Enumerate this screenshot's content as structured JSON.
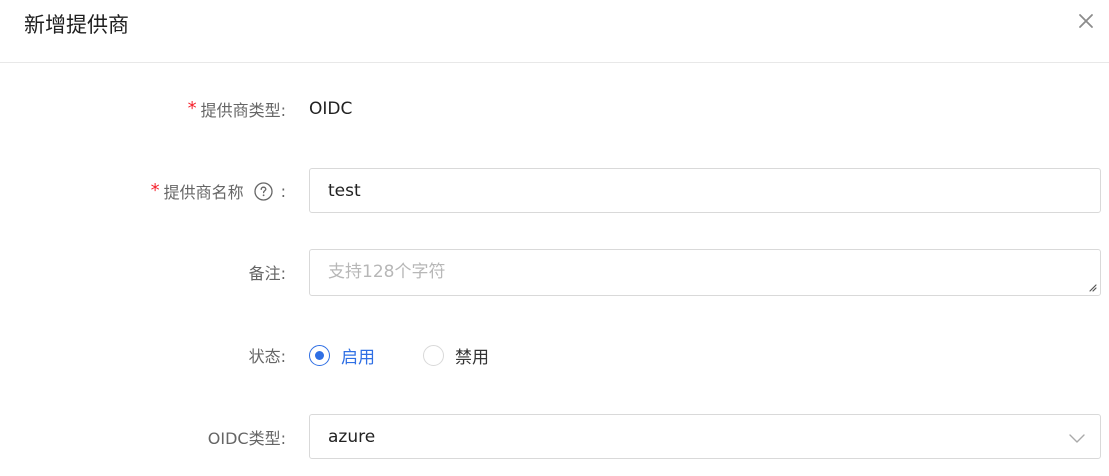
{
  "dialog": {
    "title": "新增提供商",
    "close_icon": "close-icon"
  },
  "form": {
    "provider_type": {
      "required": "*",
      "label": "提供商类型:",
      "value": "OIDC"
    },
    "provider_name": {
      "required": "*",
      "label": "提供商名称",
      "help_icon": "question-circle-icon",
      "colon": ":",
      "value": "test"
    },
    "remark": {
      "label": "备注:",
      "value": "",
      "placeholder": "支持128个字符"
    },
    "status": {
      "label": "状态:",
      "options": [
        {
          "label": "启用",
          "checked": true
        },
        {
          "label": "禁用",
          "checked": false
        }
      ]
    },
    "oidc_type": {
      "label": "OIDC类型:",
      "value": "azure",
      "dropdown_icon": "chevron-down-icon"
    }
  },
  "colors": {
    "accent": "#2f6fe4",
    "required": "#f5222d",
    "border": "#d9d9d9"
  }
}
